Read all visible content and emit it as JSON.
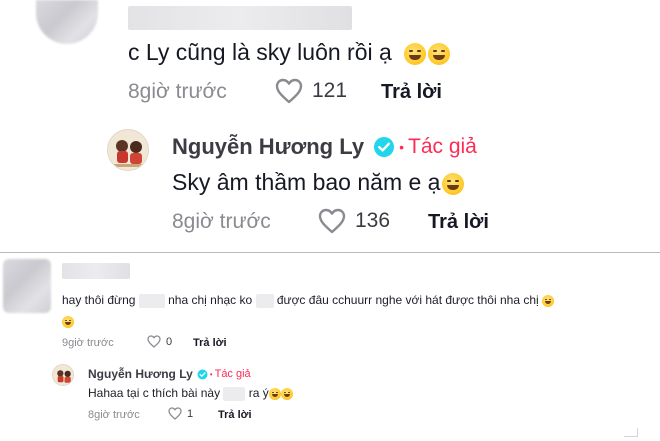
{
  "thread1": {
    "comment_text": "c Ly cũng là sky luôn rồi ạ",
    "time": "8giờ trước",
    "likes": "121",
    "reply_label": "Trả lời",
    "reply": {
      "author": "Nguyễn Hương Ly",
      "author_tag": "Tác giả",
      "text": "Sky âm thầm bao năm e ạ",
      "time": "8giờ trước",
      "likes": "136",
      "reply_label": "Trả lời"
    }
  },
  "thread2": {
    "comment_line1_a": "hay thôi đừng",
    "comment_line1_b": "nha chị nhạc ko",
    "comment_line1_c": "được đâu cchuurr nghe với hát được thôi nha chị",
    "time": "9giờ trước",
    "likes": "0",
    "reply_label": "Trả lời",
    "reply": {
      "author": "Nguyễn Hương Ly",
      "author_tag": "Tác giả",
      "text_a": "Hahaa tại c thích bài này",
      "text_b": "ra ý",
      "time": "8giờ trước",
      "likes": "1",
      "reply_label": "Trả lời"
    }
  },
  "colors": {
    "author_tag": "#fe2c55",
    "verified": "#20d5ec",
    "meta": "#8a8b91"
  },
  "icons": [
    "heart-outline-icon",
    "verified-badge-icon",
    "grinning-emoji-icon",
    "laughing-emoji-icon"
  ]
}
